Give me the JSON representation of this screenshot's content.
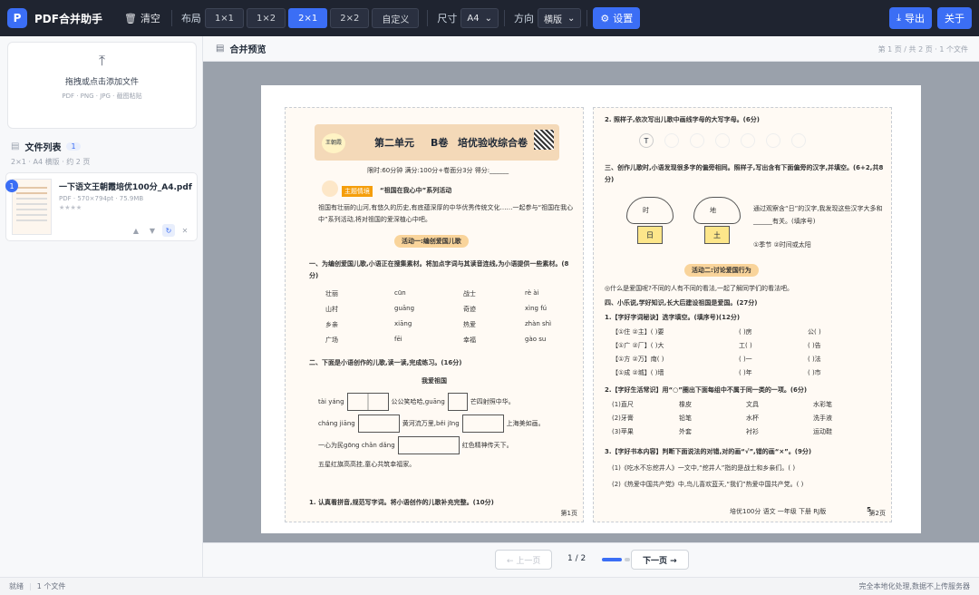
{
  "app": {
    "logo_letter": "P",
    "name": "PDF合并助手"
  },
  "toolbar": {
    "clear": "清空",
    "layout_label": "布局",
    "layouts": [
      "1×1",
      "1×2",
      "2×1",
      "2×2",
      "自定义"
    ],
    "active_layout": "2×1",
    "size_label": "尺寸",
    "size_value": "A4",
    "orientation_label": "方向",
    "orientation_value": "横版",
    "settings": "设置",
    "export": "导出",
    "about": "关于",
    "accent": "#3b6ef5"
  },
  "sidebar": {
    "drop_title": "拖拽或点击添加文件",
    "drop_hint": "PDF · PNG · JPG · 截图粘贴",
    "list_title": "文件列表",
    "list_count": "1",
    "list_sub": "2×1 · A4 横版 · 约 2 页",
    "file": {
      "index": "1",
      "name": "一下语文王朝霞培优100分_A4.pdf",
      "meta": "PDF · 570×794pt · 75.9MB",
      "rating": "★★★★"
    }
  },
  "preview": {
    "title": "合并预览",
    "page_info": "第 1 页 / 共 2 页 · 1 个文件",
    "prev": "← 上一页",
    "page": "1 / 2",
    "next": "下一页 →"
  },
  "doc": {
    "unit": "第二单元",
    "volume": "B卷",
    "heading": "培优验收综合卷",
    "meta": "限时:60分钟  满分:100分+卷面分3分  得分:______",
    "theme_tag": "主题情境",
    "theme": "“祖国在我心中”系列活动",
    "intro": "祖国有壮丽的山河,有悠久的历史,有底蕴深厚的中华优秀传统文化……一起参与“祖国在我心中”系列活动,将对祖国的爱深植心中吧。",
    "activity1": "活动一:编创爱国儿歌",
    "q1": "一、为编创爱国儿歌,小语正在搜集素材。将加点字词与其读音连线,为小语提供一些素材。(8分)",
    "q1_words": [
      "壮丽",
      "山村",
      "乡亲",
      "广场"
    ],
    "q1_pinyin": [
      "cūn",
      "guāng",
      "xiāng",
      "fēi"
    ],
    "q1_words2": [
      "战士",
      "奇迹",
      "热爱",
      "幸福"
    ],
    "q1_pinyin2": [
      "rè ài",
      "xìng fú",
      "zhàn shì",
      "gào su"
    ],
    "q2": "二、下面是小语创作的儿歌,读一读,完成练习。(16分)",
    "poem_title": "我爱祖国",
    "poem_lines": [
      "tài yáng",
      "公公笑哈哈,guāng",
      "芒四射照中华。",
      "cháng jiāng",
      "黄河流万里,běi jīng",
      "上海美如画。",
      "一心为民gōng chǎn dǎng",
      "红色精神传天下。",
      "五星红旗高高挂,童心共筑幸福家。"
    ],
    "q2_1": "1. 认真看拼音,规范写字词。将小语创作的儿歌补充完整。(10分)",
    "page_left": "第1页",
    "r_q2": "2. 照样子,依次写出儿歌中画线字母的大写字母。(6分)",
    "r_q3": "三、创作儿歌时,小语发现很多字的偏旁相同。照样子,写出含有下面偏旁的汉字,并填空。(6+2,共8分)",
    "r_flower1": "时",
    "r_flower1b": "日",
    "r_flower2": "地",
    "r_flower2b": "土",
    "r_note": "通过观察含“日”的汉字,我发现这些汉字大多和______有关。(填序号)",
    "r_opts": "①季节  ②时间或太阳",
    "activity2": "活动二:讨论爱国行为",
    "r_q_what": "◎什么是爱国呢?不同的人有不同的看法,一起了解同学们的看法吧。",
    "r_q4": "四、小乐说,学好知识,长大后建设祖国是爱国。(27分)",
    "r_q4_1": "1.【字好字词秘诀】选字填空。(填序号)(12分)",
    "r_rows": [
      [
        "【①住 ②主】(  )要",
        "(  )房",
        "公(  )"
      ],
      [
        "【①广 ②厂】(  )大",
        "工(  )",
        "(  )告"
      ],
      [
        "【①方 ②万】南(  )",
        "(  )一",
        "(  )法"
      ],
      [
        "【①成 ②城】(  )墙",
        "(  )年",
        "(  )市"
      ]
    ],
    "r_q4_2": "2.【字好生活常识】用“○”圈出下面每组中不属于同一类的一项。(6分)",
    "r_groups": [
      [
        "(1)直尺",
        "橡皮",
        "文具",
        "水彩笔"
      ],
      [
        "(2)牙膏",
        "铅笔",
        "水杯",
        "洗手液"
      ],
      [
        "(3)苹果",
        "外套",
        "衬衫",
        "运动鞋"
      ]
    ],
    "r_q4_3": "3.【字好书本内容】判断下面说法的对错,对的画“√”,错的画“×”。(9分)",
    "r_j1": "(1)《吃水不忘挖井人》一文中,“挖井人”指的是战士和乡亲们。(  )",
    "r_j2": "(2)《热爱中国共产党》中,鸟儿喜欢蓝天,“我们”热爱中国共产党。(  )",
    "footer_right": "培优100分  语文  一年级  下册  RJ版",
    "page_right": "5",
    "page_right2": "第2页"
  },
  "status": {
    "ready": "就绪",
    "files": "1 个文件",
    "privacy": "完全本地化处理,数据不上传服务器"
  }
}
